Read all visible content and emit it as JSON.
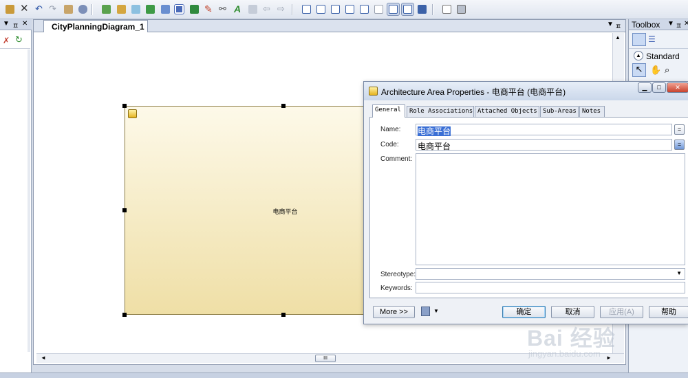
{
  "toolbar": {
    "buttons": [
      "paste",
      "delete",
      "undo",
      "redo",
      "properties",
      "model",
      "new-package",
      "package-lock",
      "find",
      "refresh",
      "check",
      "window",
      "table",
      "brush",
      "link",
      "text-color",
      "arrange",
      "back",
      "forward",
      "view1",
      "view2",
      "view3",
      "view4",
      "view5",
      "view6",
      "view7",
      "view8",
      "view9",
      "print-preview",
      "print"
    ]
  },
  "left_panel": {
    "controls": [
      "▼",
      "ㅍ",
      "✕"
    ]
  },
  "diagram": {
    "tab_label": "CityPlanningDiagram_1",
    "tab_controls": [
      "▼",
      "ㅍ",
      "✕"
    ],
    "area_symbol_label": "电商平台",
    "hscroll_thumb": "III"
  },
  "toolbox": {
    "title": "Toolbox",
    "controls": [
      "▼",
      "ㅍ",
      "✕"
    ],
    "section": "Standard"
  },
  "dialog": {
    "title": "Architecture Area Properties - 电商平台 (电商平台)",
    "tabs": [
      "General",
      "Role Associations",
      "Attached Objects",
      "Sub-Areas",
      "Notes"
    ],
    "fields": {
      "name_label": "Name:",
      "name_value": "电商平台",
      "code_label": "Code:",
      "code_value": "电商平台",
      "comment_label": "Comment:",
      "stereotype_label": "Stereotype:",
      "keywords_label": "Keywords:"
    },
    "buttons": {
      "more": "More >>",
      "ok": "确定",
      "cancel": "取消",
      "apply": "应用(A)",
      "help": "帮助"
    }
  },
  "watermark": {
    "brand": "Bai 经验",
    "url": "jingyan.baidu.com"
  }
}
